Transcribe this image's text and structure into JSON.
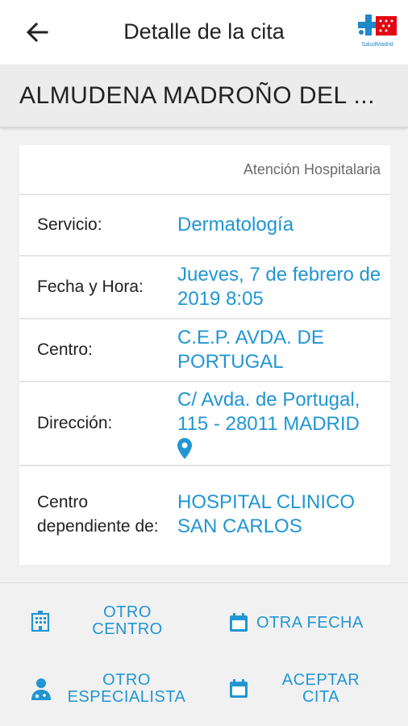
{
  "header": {
    "title": "Detalle de la cita",
    "back_icon": "arrow-left-icon",
    "logo_text": "SaludMadrid",
    "logo_color": "#e30613"
  },
  "patient": {
    "name": "ALMUDENA MADROÑO DEL ..."
  },
  "card": {
    "category": "Atención Hospitalaria",
    "rows": [
      {
        "label": "Servicio:",
        "value": "Dermatología"
      },
      {
        "label": "Fecha y Hora:",
        "value": "Jueves, 7 de febrero de 2019 8:05"
      },
      {
        "label": "Centro:",
        "value": "C.E.P. AVDA. DE PORTUGAL"
      },
      {
        "label": "Dirección:",
        "value": "C/ Avda. de Portugal, 115 - 28011 MADRID",
        "icon": "map-pin-icon"
      },
      {
        "label": "Centro dependiente de:",
        "value": "HOSPITAL CLINICO SAN CARLOS"
      }
    ]
  },
  "actions": {
    "other_center": {
      "label": "OTRO CENTRO",
      "icon": "hospital-icon"
    },
    "other_date": {
      "label": "OTRA FECHA",
      "icon": "calendar-icon"
    },
    "other_specialist": {
      "label": "OTRO ESPECIALISTA",
      "icon": "doctor-icon"
    },
    "accept": {
      "label": "ACEPTAR CITA",
      "icon": "calendar-icon"
    }
  },
  "colors": {
    "accent": "#2196d3",
    "background": "#f1f1f1"
  }
}
